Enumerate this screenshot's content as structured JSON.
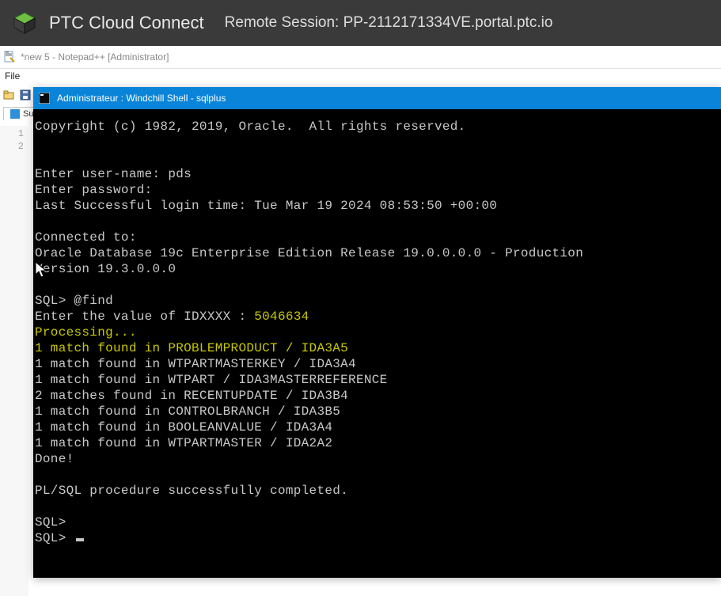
{
  "ptc": {
    "title": "PTC Cloud Connect",
    "session_label": "Remote Session: PP-2112171334VE.portal.ptc.io"
  },
  "notepadpp": {
    "window_title": "*new 5 - Notepad++ [Administrator]",
    "menu_file": "File",
    "tab_label": "Su",
    "gutter": [
      "1",
      "2"
    ]
  },
  "terminal": {
    "title": "Administrateur : Windchill Shell - sqlplus",
    "lines": [
      {
        "t": "Copyright (c) 1982, 2019, Oracle.  All rights reserved."
      },
      {
        "t": ""
      },
      {
        "t": ""
      },
      {
        "t": "Enter user-name: pds"
      },
      {
        "t": "Enter password:"
      },
      {
        "t": "Last Successful login time: Tue Mar 19 2024 08:53:50 +00:00"
      },
      {
        "t": ""
      },
      {
        "t": "Connected to:"
      },
      {
        "t": "Oracle Database 19c Enterprise Edition Release 19.0.0.0.0 - Production"
      },
      {
        "t": "Version 19.3.0.0.0"
      },
      {
        "t": ""
      },
      {
        "t": "SQL> @find"
      },
      {
        "segments": [
          {
            "t": "Enter the value of IDXXXX : "
          },
          {
            "t": "5046634",
            "c": "y"
          }
        ]
      },
      {
        "t": "Processing...",
        "c": "y"
      },
      {
        "t": "1 match found in PROBLEMPRODUCT / IDA3A5",
        "c": "y"
      },
      {
        "t": "1 match found in WTPARTMASTERKEY / IDA3A4"
      },
      {
        "t": "1 match found in WTPART / IDA3MASTERREFERENCE"
      },
      {
        "t": "2 matches found in RECENTUPDATE / IDA3B4"
      },
      {
        "t": "1 match found in CONTROLBRANCH / IDA3B5"
      },
      {
        "t": "1 match found in BOOLEANVALUE / IDA3A4"
      },
      {
        "t": "1 match found in WTPARTMASTER / IDA2A2"
      },
      {
        "t": "Done!"
      },
      {
        "t": ""
      },
      {
        "t": "PL/SQL procedure successfully completed."
      },
      {
        "t": ""
      },
      {
        "t": "SQL>"
      },
      {
        "segments": [
          {
            "t": "SQL> "
          },
          {
            "cursor": true
          }
        ]
      }
    ]
  }
}
